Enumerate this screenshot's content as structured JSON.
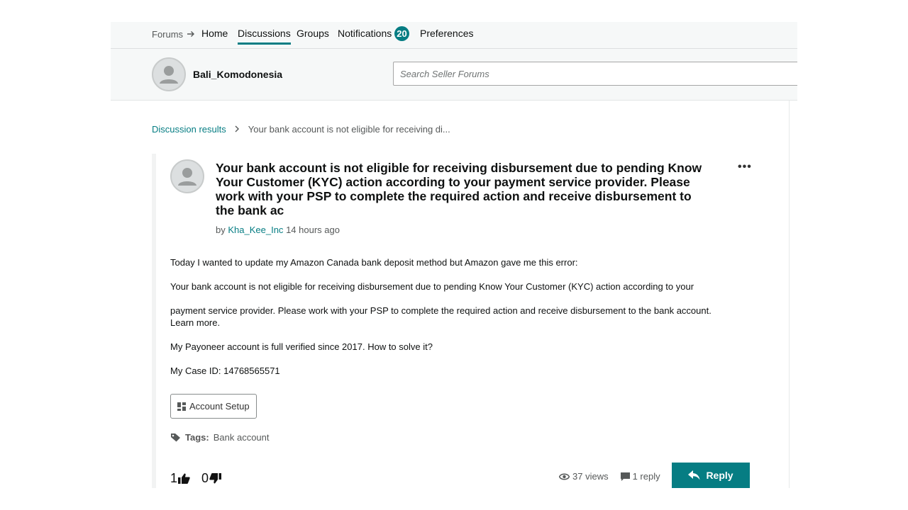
{
  "topnav": {
    "forums": "Forums",
    "home": "Home",
    "discussions": "Discussions",
    "groups": "Groups",
    "notifications": "Notifications",
    "notifications_count": "20",
    "preferences": "Preferences"
  },
  "user": {
    "name": "Bali_Komodonesia"
  },
  "search": {
    "placeholder": "Search Seller Forums"
  },
  "breadcrumb": {
    "parent": "Discussion results",
    "current": "Your bank account is not eligible for receiving di..."
  },
  "post": {
    "title": "Your bank account is not eligible for receiving disbursement due to pending Know Your Customer (KYC) action according to your payment service provider. Please work with your PSP to complete the required action and receive disbursement to the bank ac",
    "by": "by",
    "author": "Kha_Kee_Inc",
    "time": "14 hours ago",
    "paragraphs": [
      "Today I wanted to update my Amazon Canada bank deposit method but Amazon gave me this error:",
      "Your bank account is not eligible for receiving disbursement due to pending Know Your Customer (KYC) action according to your",
      "payment service provider. Please work with your PSP to complete the required action and receive disbursement to the bank account.",
      "Learn more.",
      "My Payoneer account is full verified since 2017. How to solve it?",
      "My Case ID: 14768565571"
    ],
    "category_button": "Account Setup",
    "tags_label": "Tags:",
    "tag": "Bank account",
    "upvotes": "1",
    "downvotes": "0",
    "views": "37 views",
    "replies": "1 reply",
    "reply_button": "Reply"
  },
  "colors": {
    "accent": "#067d83",
    "nav_bg": "#f6f8f8"
  }
}
